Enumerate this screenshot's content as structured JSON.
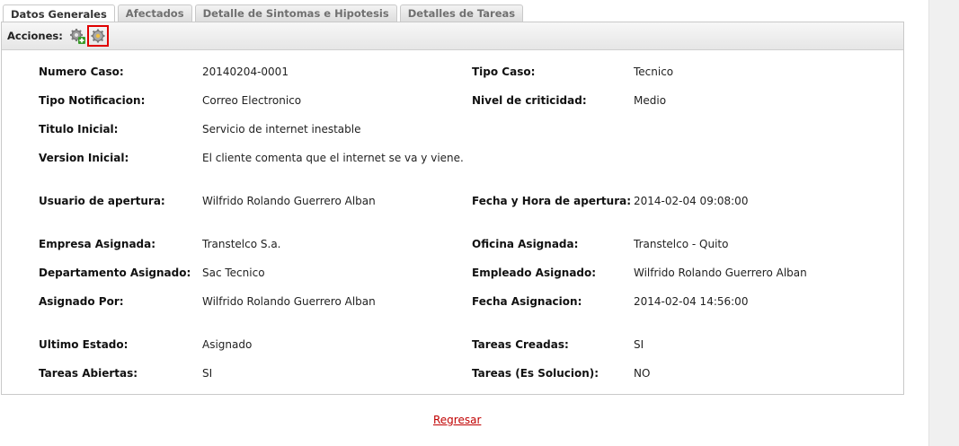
{
  "tabs": [
    {
      "label": "Datos Generales",
      "active": true
    },
    {
      "label": "Afectados",
      "active": false
    },
    {
      "label": "Detalle de Sintomas e Hipotesis",
      "active": false
    },
    {
      "label": "Detalles de Tareas",
      "active": false
    }
  ],
  "toolbar": {
    "label": "Acciones:",
    "icons": [
      "gear-add-icon",
      "gear-settings-icon"
    ]
  },
  "fields": {
    "numero_caso": {
      "label": "Numero Caso:",
      "value": "20140204-0001"
    },
    "tipo_caso": {
      "label": "Tipo Caso:",
      "value": "Tecnico"
    },
    "tipo_notificacion": {
      "label": "Tipo Notificacion:",
      "value": "Correo Electronico"
    },
    "nivel_criticidad": {
      "label": "Nivel de criticidad:",
      "value": "Medio"
    },
    "titulo_inicial": {
      "label": "Titulo Inicial:",
      "value": "Servicio de internet inestable"
    },
    "version_inicial": {
      "label": "Version Inicial:",
      "value": "El cliente comenta que el internet se va y viene."
    },
    "usuario_apertura": {
      "label": "Usuario de apertura:",
      "value": "Wilfrido Rolando Guerrero Alban"
    },
    "fecha_apertura": {
      "label": "Fecha y Hora de apertura:",
      "value": "2014-02-04 09:08:00"
    },
    "empresa_asignada": {
      "label": "Empresa Asignada:",
      "value": "Transtelco S.a."
    },
    "oficina_asignada": {
      "label": "Oficina Asignada:",
      "value": "Transtelco - Quito"
    },
    "departamento_asignado": {
      "label": "Departamento Asignado:",
      "value": "Sac Tecnico"
    },
    "empleado_asignado": {
      "label": "Empleado Asignado:",
      "value": "Wilfrido Rolando Guerrero Alban"
    },
    "asignado_por": {
      "label": "Asignado Por:",
      "value": "Wilfrido Rolando Guerrero Alban"
    },
    "fecha_asignacion": {
      "label": "Fecha Asignacion:",
      "value": "2014-02-04 14:56:00"
    },
    "ultimo_estado": {
      "label": "Ultimo Estado:",
      "value": "Asignado"
    },
    "tareas_creadas": {
      "label": "Tareas Creadas:",
      "value": "SI"
    },
    "tareas_abiertas": {
      "label": "Tareas Abiertas:",
      "value": "SI"
    },
    "tareas_solucion": {
      "label": "Tareas (Es Solucion):",
      "value": "NO"
    }
  },
  "footer": {
    "back_link": "Regresar"
  },
  "colors": {
    "link": "#c00000",
    "highlight": "#e00000",
    "gear": "#8a8a8a",
    "plus": "#3a9a2a"
  }
}
